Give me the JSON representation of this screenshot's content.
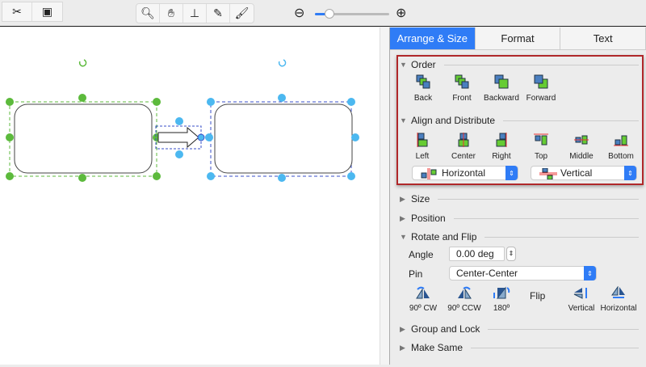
{
  "toolbar": {
    "left_tools": [
      "connector-tool-icon",
      "page-setup-icon"
    ],
    "center_tools": [
      "zoom-icon",
      "hand-icon",
      "stamp-icon",
      "eyedropper-icon",
      "format-brush-icon"
    ],
    "zoom_level": 0.2
  },
  "panel": {
    "tabs": [
      "Arrange & Size",
      "Format",
      "Text"
    ],
    "order": {
      "title": "Order",
      "buttons": [
        "Back",
        "Front",
        "Backward",
        "Forward"
      ]
    },
    "align": {
      "title": "Align and Distribute",
      "buttons": [
        "Left",
        "Center",
        "Right",
        "Top",
        "Middle",
        "Bottom"
      ],
      "horizontal": "Horizontal",
      "vertical": "Vertical"
    },
    "size": "Size",
    "position": "Position",
    "rotate": {
      "title": "Rotate and Flip",
      "angle_label": "Angle",
      "angle_value": "0.00 deg",
      "pin_label": "Pin",
      "pin_value": "Center-Center",
      "buttons": [
        "90º CW",
        "90º CCW",
        "180º"
      ],
      "flip_label": "Flip",
      "flip_buttons": [
        "Vertical",
        "Horizontal"
      ]
    },
    "group": "Group and Lock",
    "make_same": "Make Same"
  },
  "colors": {
    "accent": "#2f7cf6",
    "highlight": "#b0282a",
    "green_handle": "#5cba3c",
    "blue_handle": "#4cb8f0"
  }
}
